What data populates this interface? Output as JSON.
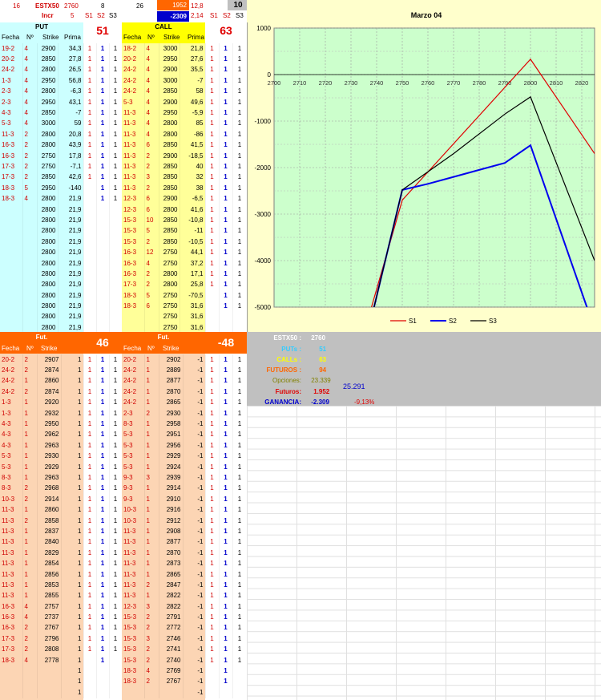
{
  "top": {
    "cells": [
      "16",
      "ESTX50",
      "2760",
      "8",
      "26",
      "1952",
      "12,8",
      "10"
    ],
    "row2": [
      "Incr",
      "5",
      "S1",
      "S2",
      "S3",
      "-2309",
      "2,14",
      "S1",
      "S2",
      "S3"
    ]
  },
  "put": {
    "title": "PUT",
    "count": "51",
    "headers": [
      "Fecha",
      "Nº",
      "Strike",
      "Prima"
    ],
    "rows": [
      [
        "19-2",
        "4",
        "2900",
        "34,3",
        "1",
        "1",
        "1"
      ],
      [
        "20-2",
        "4",
        "2850",
        "27,8",
        "1",
        "1",
        "1"
      ],
      [
        "24-2",
        "4",
        "2800",
        "26,5",
        "1",
        "1",
        "1"
      ],
      [
        "1-3",
        "4",
        "2950",
        "56,8",
        "1",
        "1",
        "1"
      ],
      [
        "2-3",
        "4",
        "2800",
        "-6,3",
        "1",
        "1",
        "1"
      ],
      [
        "2-3",
        "4",
        "2950",
        "43,1",
        "1",
        "1",
        "1"
      ],
      [
        "4-3",
        "4",
        "2850",
        "-7",
        "1",
        "1",
        "1"
      ],
      [
        "5-3",
        "4",
        "3000",
        "59",
        "1",
        "1",
        "1"
      ],
      [
        "11-3",
        "2",
        "2800",
        "20,8",
        "1",
        "1",
        "1"
      ],
      [
        "16-3",
        "2",
        "2800",
        "43,9",
        "1",
        "1",
        "1"
      ],
      [
        "16-3",
        "2",
        "2750",
        "17,8",
        "1",
        "1",
        "1"
      ],
      [
        "17-3",
        "2",
        "2750",
        "-7,1",
        "1",
        "1",
        "1"
      ],
      [
        "17-3",
        "2",
        "2850",
        "42,6",
        "1",
        "1",
        "1"
      ],
      [
        "18-3",
        "5",
        "2950",
        "-140",
        "",
        "1",
        "1"
      ],
      [
        "18-3",
        "4",
        "2800",
        "21,9",
        "",
        "1",
        "1"
      ],
      [
        "",
        "",
        "2800",
        "21,9",
        "",
        "",
        ""
      ],
      [
        "",
        "",
        "2800",
        "21,9",
        "",
        "",
        ""
      ],
      [
        "",
        "",
        "2800",
        "21,9",
        "",
        "",
        ""
      ],
      [
        "",
        "",
        "2800",
        "21,9",
        "",
        "",
        ""
      ],
      [
        "",
        "",
        "2800",
        "21,9",
        "",
        "",
        ""
      ],
      [
        "",
        "",
        "2800",
        "21,9",
        "",
        "",
        ""
      ],
      [
        "",
        "",
        "2800",
        "21,9",
        "",
        "",
        ""
      ],
      [
        "",
        "",
        "2800",
        "21,9",
        "",
        "",
        ""
      ],
      [
        "",
        "",
        "2800",
        "21,9",
        "",
        "",
        ""
      ],
      [
        "",
        "",
        "2800",
        "21,9",
        "",
        "",
        ""
      ],
      [
        "",
        "",
        "2800",
        "21,9",
        "",
        "",
        ""
      ],
      [
        "",
        "",
        "2800",
        "21,9",
        "",
        "",
        ""
      ]
    ]
  },
  "call": {
    "title": "CALL",
    "count": "63",
    "headers": [
      "Fecha",
      "Nº",
      "Strike",
      "Prima"
    ],
    "rows": [
      [
        "18-2",
        "4",
        "3000",
        "21,8",
        "1",
        "1",
        "1"
      ],
      [
        "20-2",
        "4",
        "2950",
        "27,6",
        "1",
        "1",
        "1"
      ],
      [
        "24-2",
        "4",
        "2900",
        "35,5",
        "1",
        "1",
        "1"
      ],
      [
        "24-2",
        "4",
        "3000",
        "-7",
        "1",
        "1",
        "1"
      ],
      [
        "24-2",
        "4",
        "2850",
        "58",
        "1",
        "1",
        "1"
      ],
      [
        "5-3",
        "4",
        "2900",
        "49,6",
        "1",
        "1",
        "1"
      ],
      [
        "11-3",
        "4",
        "2950",
        "-5,9",
        "1",
        "1",
        "1"
      ],
      [
        "11-3",
        "4",
        "2800",
        "85",
        "1",
        "1",
        "1"
      ],
      [
        "11-3",
        "4",
        "2800",
        "-86",
        "1",
        "1",
        "1"
      ],
      [
        "11-3",
        "6",
        "2850",
        "41,5",
        "1",
        "1",
        "1"
      ],
      [
        "11-3",
        "2",
        "2900",
        "-18,5",
        "1",
        "1",
        "1"
      ],
      [
        "11-3",
        "2",
        "2850",
        "40",
        "1",
        "1",
        "1"
      ],
      [
        "11-3",
        "3",
        "2850",
        "32",
        "1",
        "1",
        "1"
      ],
      [
        "11-3",
        "2",
        "2850",
        "38",
        "1",
        "1",
        "1"
      ],
      [
        "12-3",
        "6",
        "2900",
        "-6,5",
        "1",
        "1",
        "1"
      ],
      [
        "12-3",
        "6",
        "2800",
        "41,6",
        "1",
        "1",
        "1"
      ],
      [
        "15-3",
        "10",
        "2850",
        "-10,8",
        "1",
        "1",
        "1"
      ],
      [
        "15-3",
        "5",
        "2850",
        "-11",
        "1",
        "1",
        "1"
      ],
      [
        "15-3",
        "2",
        "2850",
        "-10,5",
        "1",
        "1",
        "1"
      ],
      [
        "16-3",
        "12",
        "2750",
        "44,1",
        "1",
        "1",
        "1"
      ],
      [
        "16-3",
        "4",
        "2750",
        "37,2",
        "1",
        "1",
        "1"
      ],
      [
        "16-3",
        "2",
        "2800",
        "17,1",
        "1",
        "1",
        "1"
      ],
      [
        "17-3",
        "2",
        "2800",
        "25,8",
        "1",
        "1",
        "1"
      ],
      [
        "18-3",
        "5",
        "2750",
        "-70,5",
        "",
        "1",
        "1"
      ],
      [
        "18-3",
        "6",
        "2750",
        "31,6",
        "",
        "1",
        "1"
      ],
      [
        "",
        "",
        "2750",
        "31,6",
        "",
        "",
        ""
      ],
      [
        "",
        "",
        "2750",
        "31,6",
        "",
        "",
        ""
      ]
    ]
  },
  "fut_left": {
    "title": "Fut.",
    "count": "46",
    "headers": [
      "Fecha",
      "Nº",
      "Strike"
    ],
    "rows": [
      [
        "20-2",
        "2",
        "2907",
        "1",
        "1",
        "1",
        "1"
      ],
      [
        "24-2",
        "2",
        "2874",
        "1",
        "1",
        "1",
        "1"
      ],
      [
        "24-2",
        "1",
        "2860",
        "1",
        "1",
        "1",
        "1"
      ],
      [
        "24-2",
        "2",
        "2874",
        "1",
        "1",
        "1",
        "1"
      ],
      [
        "1-3",
        "1",
        "2920",
        "1",
        "1",
        "1",
        "1"
      ],
      [
        "1-3",
        "1",
        "2932",
        "1",
        "1",
        "1",
        "1"
      ],
      [
        "4-3",
        "1",
        "2950",
        "1",
        "1",
        "1",
        "1"
      ],
      [
        "4-3",
        "1",
        "2962",
        "1",
        "1",
        "1",
        "1"
      ],
      [
        "4-3",
        "1",
        "2963",
        "1",
        "1",
        "1",
        "1"
      ],
      [
        "5-3",
        "1",
        "2930",
        "1",
        "1",
        "1",
        "1"
      ],
      [
        "5-3",
        "1",
        "2929",
        "1",
        "1",
        "1",
        "1"
      ],
      [
        "8-3",
        "1",
        "2963",
        "1",
        "1",
        "1",
        "1"
      ],
      [
        "8-3",
        "2",
        "2968",
        "1",
        "1",
        "1",
        "1"
      ],
      [
        "10-3",
        "2",
        "2914",
        "1",
        "1",
        "1",
        "1"
      ],
      [
        "11-3",
        "1",
        "2860",
        "1",
        "1",
        "1",
        "1"
      ],
      [
        "11-3",
        "2",
        "2858",
        "1",
        "1",
        "1",
        "1"
      ],
      [
        "11-3",
        "1",
        "2837",
        "1",
        "1",
        "1",
        "1"
      ],
      [
        "11-3",
        "1",
        "2840",
        "1",
        "1",
        "1",
        "1"
      ],
      [
        "11-3",
        "1",
        "2829",
        "1",
        "1",
        "1",
        "1"
      ],
      [
        "11-3",
        "1",
        "2854",
        "1",
        "1",
        "1",
        "1"
      ],
      [
        "11-3",
        "1",
        "2856",
        "1",
        "1",
        "1",
        "1"
      ],
      [
        "11-3",
        "1",
        "2853",
        "1",
        "1",
        "1",
        "1"
      ],
      [
        "11-3",
        "1",
        "2855",
        "1",
        "1",
        "1",
        "1"
      ],
      [
        "16-3",
        "4",
        "2757",
        "1",
        "1",
        "1",
        "1"
      ],
      [
        "16-3",
        "4",
        "2737",
        "1",
        "1",
        "1",
        "1"
      ],
      [
        "16-3",
        "2",
        "2767",
        "1",
        "1",
        "1",
        "1"
      ],
      [
        "17-3",
        "2",
        "2796",
        "1",
        "1",
        "1",
        "1"
      ],
      [
        "17-3",
        "2",
        "2808",
        "1",
        "1",
        "1",
        "1"
      ],
      [
        "18-3",
        "4",
        "2778",
        "1",
        "",
        "1",
        ""
      ],
      [
        "",
        "",
        "",
        "1",
        "",
        "",
        ""
      ],
      [
        "",
        "",
        "",
        "1",
        "",
        "",
        ""
      ],
      [
        "",
        "",
        "",
        "1",
        "",
        "",
        ""
      ]
    ]
  },
  "fut_right": {
    "title": "Fut.",
    "count": "-48",
    "headers": [
      "Fecha",
      "Nº",
      "Strike"
    ],
    "rows": [
      [
        "20-2",
        "1",
        "2902",
        "-1",
        "1",
        "1",
        "1"
      ],
      [
        "24-2",
        "1",
        "2889",
        "-1",
        "1",
        "1",
        "1"
      ],
      [
        "24-2",
        "1",
        "2877",
        "-1",
        "1",
        "1",
        "1"
      ],
      [
        "24-2",
        "1",
        "2870",
        "-1",
        "1",
        "1",
        "1"
      ],
      [
        "24-2",
        "1",
        "2865",
        "-1",
        "1",
        "1",
        "1"
      ],
      [
        "2-3",
        "2",
        "2930",
        "-1",
        "1",
        "1",
        "1"
      ],
      [
        "8-3",
        "1",
        "2958",
        "-1",
        "1",
        "1",
        "1"
      ],
      [
        "5-3",
        "1",
        "2951",
        "-1",
        "1",
        "1",
        "1"
      ],
      [
        "5-3",
        "1",
        "2956",
        "-1",
        "1",
        "1",
        "1"
      ],
      [
        "5-3",
        "1",
        "2929",
        "-1",
        "1",
        "1",
        "1"
      ],
      [
        "5-3",
        "1",
        "2924",
        "-1",
        "1",
        "1",
        "1"
      ],
      [
        "9-3",
        "3",
        "2939",
        "-1",
        "1",
        "1",
        "1"
      ],
      [
        "9-3",
        "1",
        "2914",
        "-1",
        "1",
        "1",
        "1"
      ],
      [
        "9-3",
        "1",
        "2910",
        "-1",
        "1",
        "1",
        "1"
      ],
      [
        "10-3",
        "1",
        "2916",
        "-1",
        "1",
        "1",
        "1"
      ],
      [
        "10-3",
        "1",
        "2912",
        "-1",
        "1",
        "1",
        "1"
      ],
      [
        "11-3",
        "1",
        "2908",
        "-1",
        "1",
        "1",
        "1"
      ],
      [
        "11-3",
        "1",
        "2877",
        "-1",
        "1",
        "1",
        "1"
      ],
      [
        "11-3",
        "1",
        "2870",
        "-1",
        "1",
        "1",
        "1"
      ],
      [
        "11-3",
        "1",
        "2873",
        "-1",
        "1",
        "1",
        "1"
      ],
      [
        "11-3",
        "1",
        "2865",
        "-1",
        "1",
        "1",
        "1"
      ],
      [
        "11-3",
        "2",
        "2847",
        "-1",
        "1",
        "1",
        "1"
      ],
      [
        "11-3",
        "1",
        "2822",
        "-1",
        "1",
        "1",
        "1"
      ],
      [
        "12-3",
        "3",
        "2822",
        "-1",
        "1",
        "1",
        "1"
      ],
      [
        "15-3",
        "2",
        "2791",
        "-1",
        "1",
        "1",
        "1"
      ],
      [
        "15-3",
        "2",
        "2772",
        "-1",
        "1",
        "1",
        "1"
      ],
      [
        "15-3",
        "3",
        "2746",
        "-1",
        "1",
        "1",
        "1"
      ],
      [
        "15-3",
        "2",
        "2741",
        "-1",
        "1",
        "1",
        "1"
      ],
      [
        "15-3",
        "2",
        "2740",
        "-1",
        "1",
        "1",
        "1"
      ],
      [
        "18-3",
        "4",
        "2769",
        "-1",
        "",
        "1",
        ""
      ],
      [
        "18-3",
        "2",
        "2767",
        "-1",
        "",
        "1",
        ""
      ],
      [
        "",
        "",
        "",
        "-1",
        "",
        "",
        ""
      ]
    ]
  },
  "summary": {
    "estx": {
      "label": "ESTX50 :",
      "value": "2760"
    },
    "puts": {
      "label": "PUTs :",
      "value": "51"
    },
    "calls": {
      "label": "CALLs :",
      "value": "63"
    },
    "futuros": {
      "label": "FUTUROS :",
      "value": "94"
    },
    "opciones": {
      "label": "Opciones:",
      "value": "23.339"
    },
    "fut2": {
      "label": "Futuros:",
      "value": "1.952"
    },
    "ganancia": {
      "label": "GANANCIA:",
      "value": "-2.309"
    },
    "total": "25.291",
    "pct": "-9,13%"
  },
  "chart_data": {
    "type": "line",
    "title": "Marzo 04",
    "x": [
      2700,
      2710,
      2720,
      2730,
      2740,
      2750,
      2760,
      2770,
      2780,
      2790,
      2800,
      2810,
      2820
    ],
    "ylim": [
      -5000,
      1000
    ],
    "xlim": [
      2700,
      2825
    ],
    "yticks": [
      "1000",
      "0",
      "-1000",
      "-2000",
      "-3000",
      "-4000",
      "-5000"
    ],
    "xticks": [
      "2700",
      "2710",
      "2720",
      "2730",
      "2740",
      "2750",
      "2760",
      "2770",
      "2780",
      "2790",
      "2800",
      "2810",
      "2820"
    ],
    "grid": true,
    "legend_position": "bottom",
    "plot_bg": "#ccffcc",
    "series": [
      {
        "name": "S1",
        "color": "#e00000",
        "points": [
          [
            2738,
            -5000
          ],
          [
            2750,
            -2700
          ],
          [
            2800,
            330
          ],
          [
            2825,
            -1700
          ]
        ]
      },
      {
        "name": "S2",
        "color": "#0000ee",
        "points": [
          [
            2739,
            -5000
          ],
          [
            2750,
            -2480
          ],
          [
            2760,
            -2350
          ],
          [
            2770,
            -2200
          ],
          [
            2780,
            -2050
          ],
          [
            2790,
            -1900
          ],
          [
            2800,
            -1520
          ],
          [
            2822,
            -5000
          ]
        ]
      },
      {
        "name": "S3",
        "color": "#000000",
        "points": [
          [
            2739,
            -5000
          ],
          [
            2750,
            -2480
          ],
          [
            2770,
            -1700
          ],
          [
            2790,
            -850
          ],
          [
            2800,
            -480
          ],
          [
            2825,
            -4000
          ]
        ]
      }
    ]
  }
}
